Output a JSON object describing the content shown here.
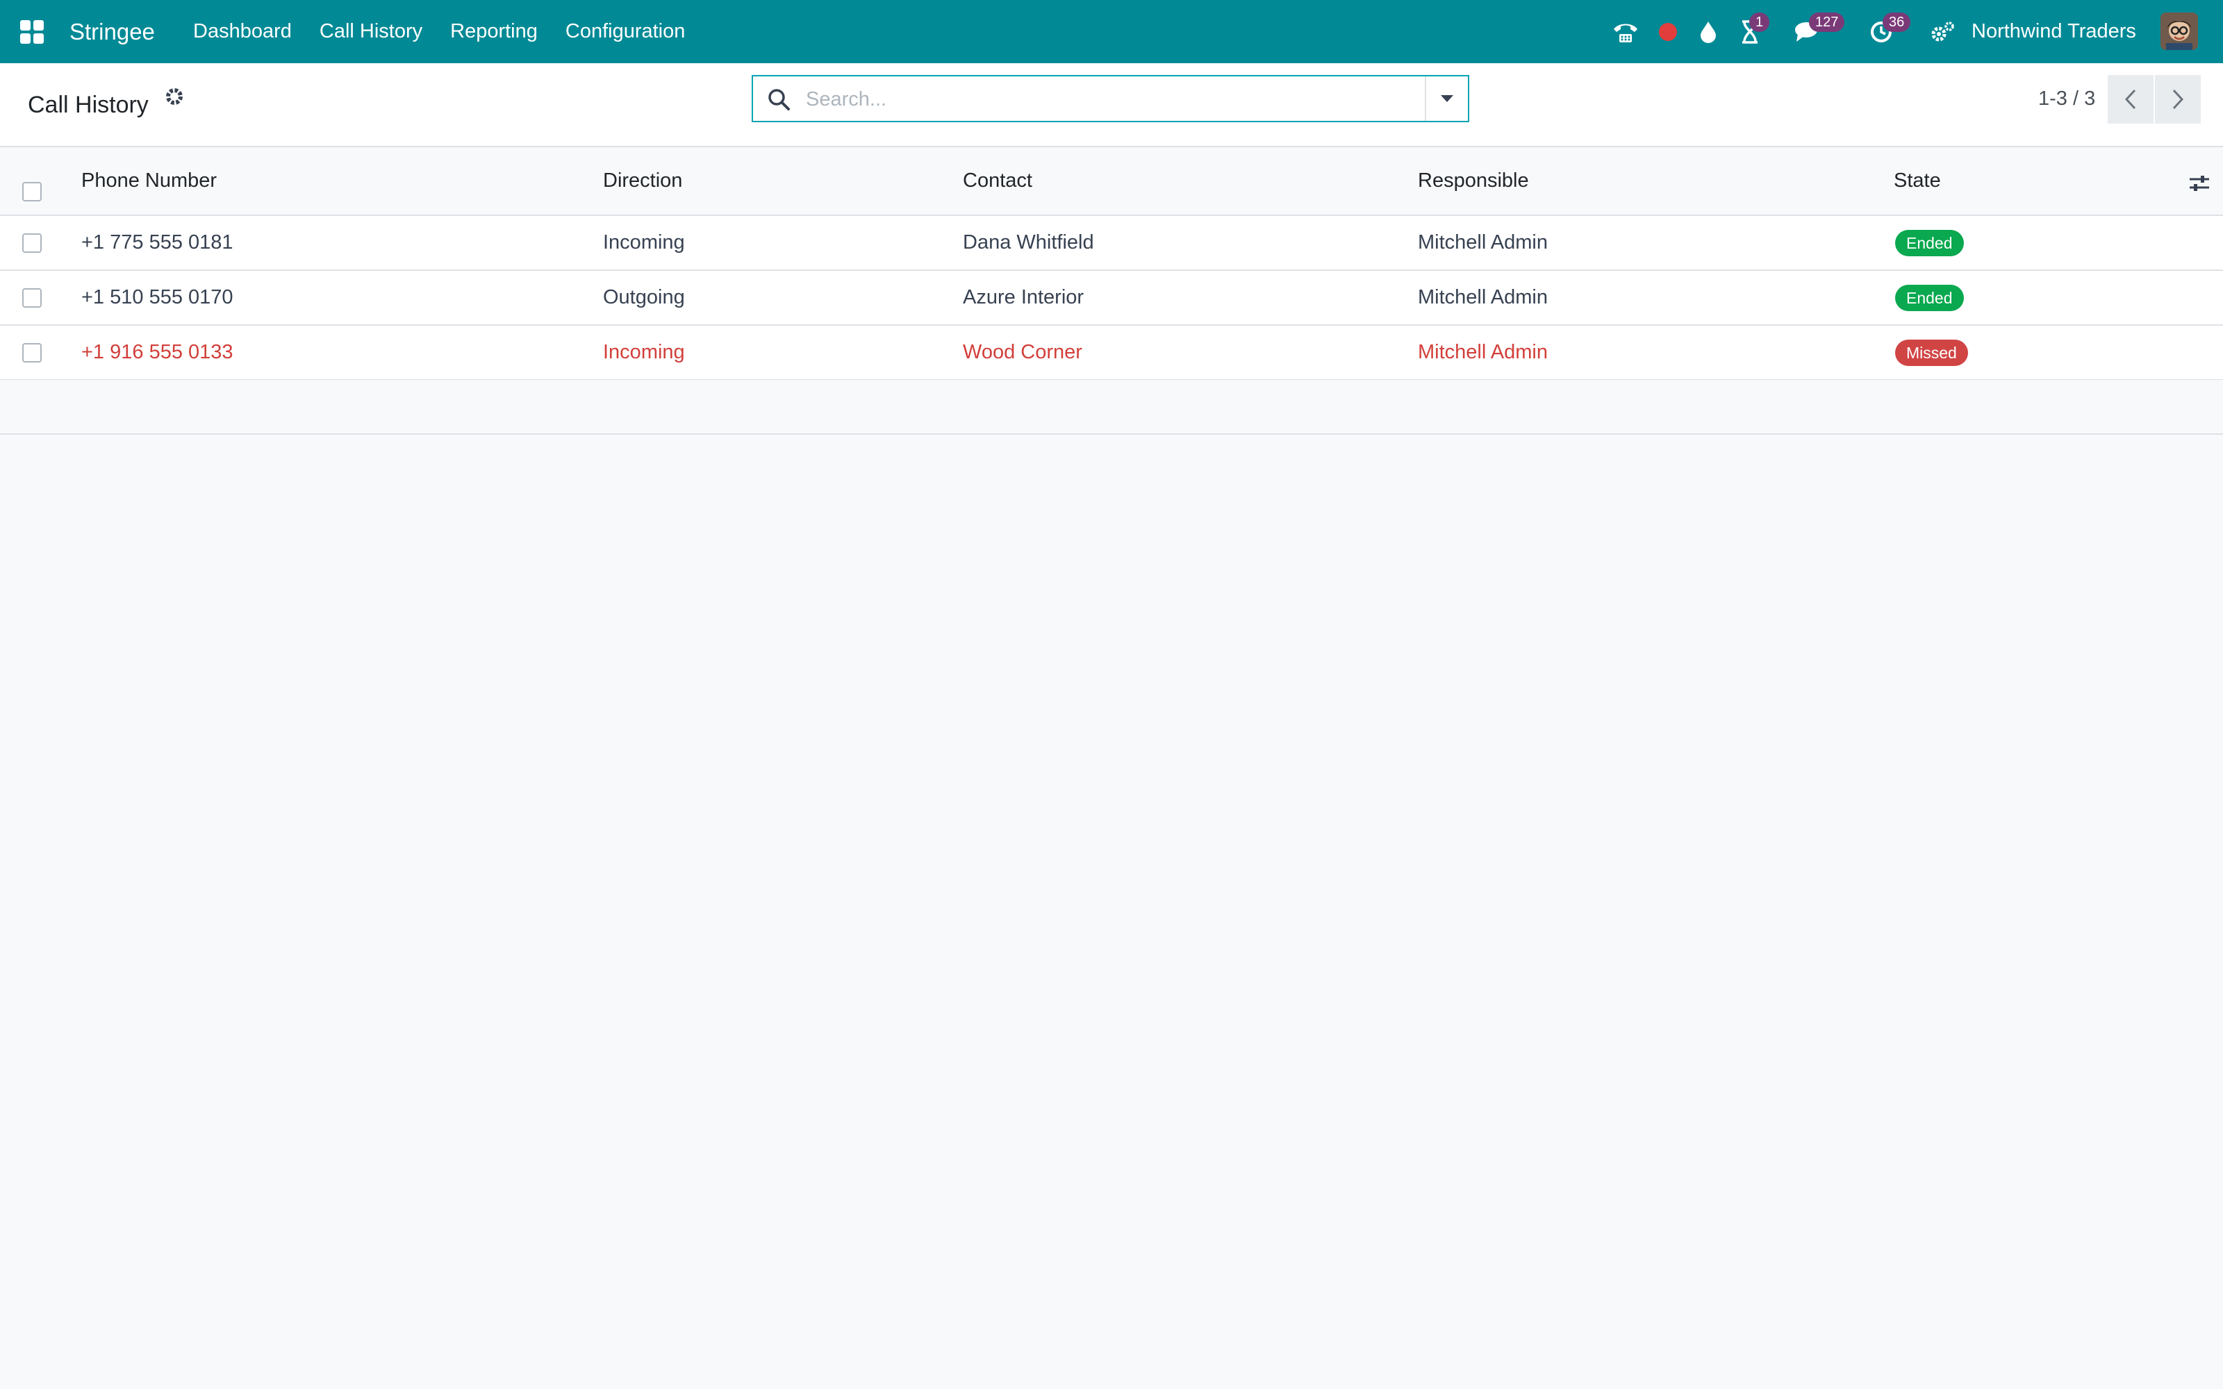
{
  "navbar": {
    "brand": "Stringee",
    "menu": [
      "Dashboard",
      "Call History",
      "Reporting",
      "Configuration"
    ],
    "badges": {
      "activities": "1",
      "messages": "127",
      "timer": "36"
    },
    "company": "Northwind Traders",
    "colors": {
      "bar": "#018a96",
      "badge": "#7a3a78",
      "recording_dot": "#e23d3d"
    },
    "icons": [
      "apps-grid-icon",
      "phone-icon",
      "record-dot-icon",
      "drop-icon",
      "hourglass-icon",
      "chat-icon",
      "clock-icon",
      "settings-icon"
    ]
  },
  "control": {
    "title": "Call History",
    "search_placeholder": "Search...",
    "pager": "1-3 / 3"
  },
  "table": {
    "headers": [
      "Phone Number",
      "Direction",
      "Contact",
      "Responsible",
      "State"
    ],
    "rows": [
      {
        "phone": "+1 775 555 0181",
        "direction": "Incoming",
        "contact": "Dana Whitfield",
        "responsible": "Mitchell Admin",
        "state": "Ended",
        "state_color": "#0aa84f",
        "missed": false
      },
      {
        "phone": "+1 510 555 0170",
        "direction": "Outgoing",
        "contact": "Azure Interior",
        "responsible": "Mitchell Admin",
        "state": "Ended",
        "state_color": "#0aa84f",
        "missed": false
      },
      {
        "phone": "+1 916 555 0133",
        "direction": "Incoming",
        "contact": "Wood Corner",
        "responsible": "Mitchell Admin",
        "state": "Missed",
        "state_color": "#d14444",
        "missed": true
      }
    ],
    "missed_text_color": "#d23f3a"
  }
}
